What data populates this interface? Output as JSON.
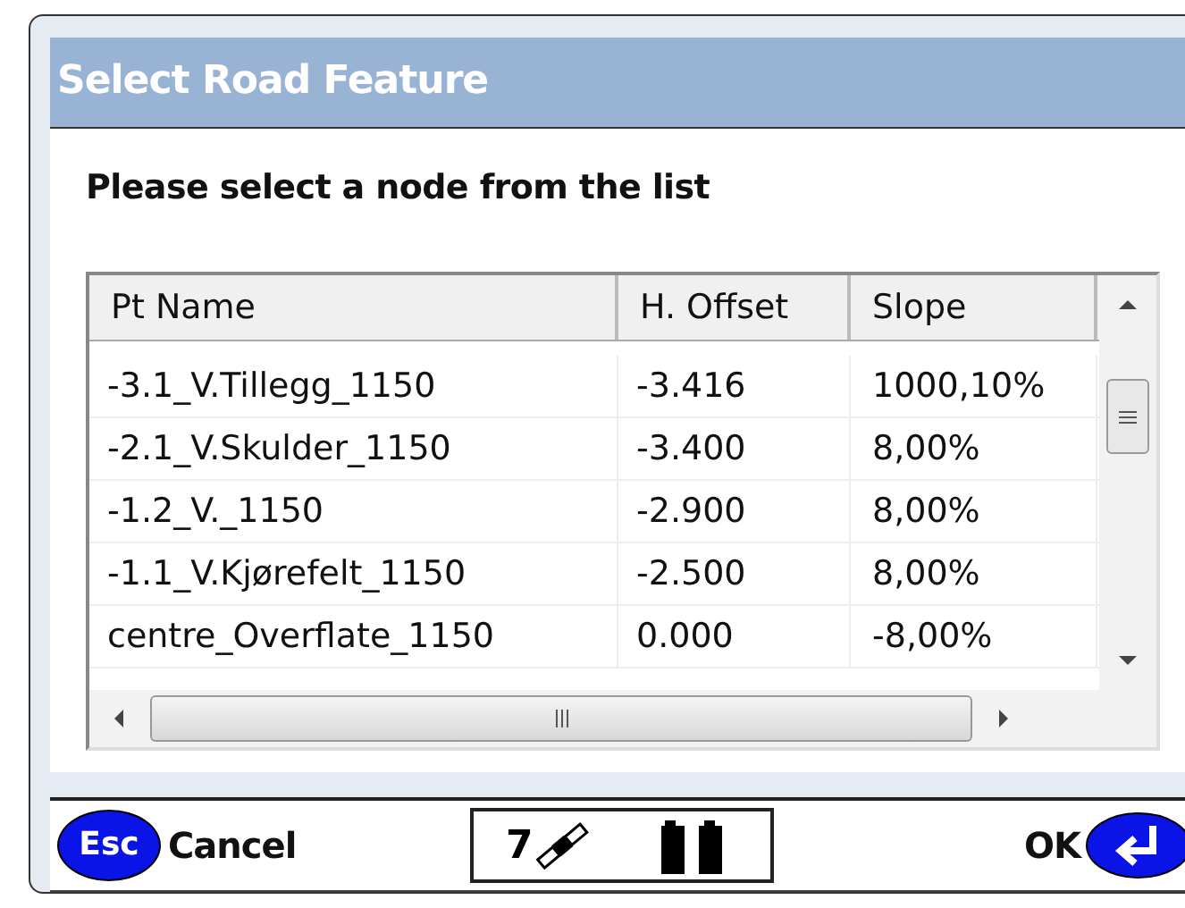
{
  "window": {
    "title": "Select Road Feature"
  },
  "instruction": "Please select a node from the list",
  "table": {
    "columns": [
      "Pt Name",
      "H. Offset",
      "Slope"
    ],
    "rows": [
      {
        "cells": [
          "-3.1_V.Tillegg_1150",
          "-3.416",
          "1000,10%"
        ]
      },
      {
        "cells": [
          "-2.1_V.Skulder_1150",
          "-3.400",
          "8,00%"
        ]
      },
      {
        "cells": [
          "-1.2_V._1150",
          "-2.900",
          "8,00%"
        ]
      },
      {
        "cells": [
          "-1.1_V.Kjørefelt_1150",
          "-2.500",
          "8,00%"
        ]
      },
      {
        "cells": [
          "centre_Overflate_1150",
          "0.000",
          "-8,00%"
        ]
      }
    ]
  },
  "footer": {
    "esc_key": "Esc",
    "cancel": "Cancel",
    "satellites": "7",
    "ok": "OK"
  }
}
